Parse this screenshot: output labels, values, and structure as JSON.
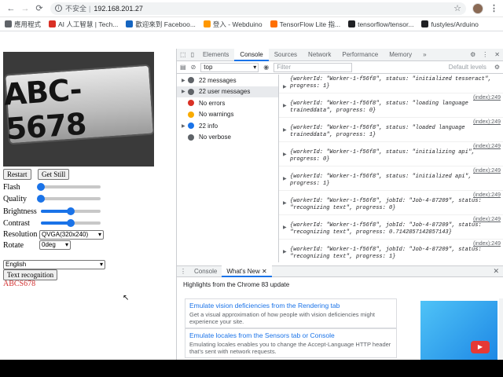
{
  "browser": {
    "insecure_label": "不安全",
    "url": "192.168.201.27",
    "bookmarks": [
      {
        "label": "應用程式",
        "icon": "apps-grid-icon",
        "color": "#5f6368"
      },
      {
        "label": "AI 人工智慧 | Tech...",
        "icon": "site-icon",
        "color": "#d93025"
      },
      {
        "label": "歡迎來到 Faceboo...",
        "icon": "site-icon",
        "color": "#1565c0"
      },
      {
        "label": "登入 - Webduino",
        "icon": "site-icon",
        "color": "#ff9800"
      },
      {
        "label": "TensorFlow Lite 指...",
        "icon": "tensorflow-icon",
        "color": "#ff6f00"
      },
      {
        "label": "tensorflow/tensor...",
        "icon": "github-icon",
        "color": "#202124"
      },
      {
        "label": "fustyles/Arduino",
        "icon": "github-icon",
        "color": "#202124"
      }
    ]
  },
  "page": {
    "plate_text": "ABC-5678",
    "restart_label": "Restart",
    "get_still_label": "Get Still",
    "flash_label": "Flash",
    "quality_label": "Quality",
    "brightness_label": "Brightness",
    "contrast_label": "Contrast",
    "resolution_label": "Resolution",
    "rotate_label": "Rotate",
    "resolution_value": "QVGA(320x240)",
    "rotate_value": "0deg",
    "language_value": "English",
    "text_recognition_label": "Text recognition",
    "result_text": "ABCS678",
    "sliders": {
      "flash": 0.0,
      "quality": 0.0,
      "brightness": 0.5,
      "contrast": 0.5
    }
  },
  "devtools": {
    "tabs": [
      "Elements",
      "Console",
      "Sources",
      "Network",
      "Performance",
      "Memory"
    ],
    "more_tabs": "»",
    "context": "top",
    "filter_placeholder": "Filter",
    "levels": "Default levels",
    "sidebar": [
      {
        "label": "22 messages",
        "icon": "list-icon",
        "color": "#5f6368"
      },
      {
        "label": "22 user messages",
        "icon": "user-icon",
        "color": "#5f6368"
      },
      {
        "label": "No errors",
        "icon": "error-icon",
        "color": "#d93025"
      },
      {
        "label": "No warnings",
        "icon": "warning-icon",
        "color": "#f9ab00"
      },
      {
        "label": "22 info",
        "icon": "info-icon",
        "color": "#1a73e8"
      },
      {
        "label": "No verbose",
        "icon": "verbose-icon",
        "color": "#5f6368"
      }
    ],
    "messages": [
      {
        "src": "",
        "text": "{workerId: \"Worker-1-f56f8\", status: \"initialized tesseract\", progress: 1}"
      },
      {
        "src": "(index):249",
        "text": "{workerId: \"Worker-1-f56f8\", status: \"loading language traineddata\", progress: 0}"
      },
      {
        "src": "(index):249",
        "text": "{workerId: \"Worker-1-f56f8\", status: \"loaded language traineddata\", progress: 1}"
      },
      {
        "src": "(index):249",
        "text": "{workerId: \"Worker-1-f56f8\", status: \"initializing api\", progress: 0}"
      },
      {
        "src": "(index):249",
        "text": "{workerId: \"Worker-1-f56f8\", status: \"initialized api\", progress: 1}"
      },
      {
        "src": "(index):249",
        "text": "{workerId: \"Worker-1-f56f8\", jobId: \"Job-4-87209\", status: \"recognizing text\", progress: 0}"
      },
      {
        "src": "(index):249",
        "text": "{workerId: \"Worker-1-f56f8\", jobId: \"Job-4-87209\", status: \"recognizing text\", progress: 0.7142857142857143}"
      },
      {
        "src": "(index):249",
        "text": "{workerId: \"Worker-1-f56f8\", jobId: \"Job-4-87209\", status: \"recognizing text\", progress: 1}"
      }
    ],
    "prompt": "›",
    "drawer_tabs": [
      "Console",
      "What's New"
    ],
    "drawer_title": "Highlights from the Chrome 83 update",
    "whats_new": [
      {
        "title": "Emulate vision deficiencies from the Rendering tab",
        "desc": "Get a visual approximation of how people with vision deficiencies might experience your site."
      },
      {
        "title": "Emulate locales from the Sensors tab or Console",
        "desc": "Emulating locales enables you to change the Accept-Language HTTP header that's sent with network requests."
      }
    ]
  },
  "colors": {
    "accent": "#1a73e8",
    "result": "#d32f2f"
  }
}
